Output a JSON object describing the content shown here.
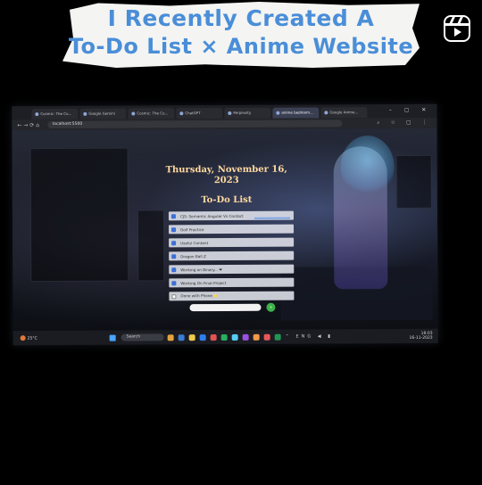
{
  "caption": {
    "line1": "I Recently Created A",
    "line2": "To-Do List × Anime Website"
  },
  "reels_icon": "reels-icon",
  "browser": {
    "tabs": [
      {
        "label": "Cosmic: The Cu..."
      },
      {
        "label": "Google Gemini"
      },
      {
        "label": "Cosmic: The Cu..."
      },
      {
        "label": "ChatGPT"
      },
      {
        "label": "Perplexity"
      },
      {
        "label": "anime bedroom...",
        "active": true
      },
      {
        "label": "Google Anime..."
      }
    ],
    "window_controls": "– ▢ ✕",
    "url": "localhost:5500",
    "nav_icons": "← → ⟳ ⌂"
  },
  "page": {
    "date_heading": "Thursday, November 16, 2023",
    "list_heading": "To-Do List",
    "items": [
      {
        "text": "CJS: Semantic Angular Vs Contact",
        "done": true
      },
      {
        "text": "Golf Practice",
        "done": true
      },
      {
        "text": "Useful Content",
        "done": true
      },
      {
        "text": "Dragon Ball Z",
        "done": true
      },
      {
        "text": "Working on Binary...  ❤",
        "done": true
      },
      {
        "text": "Working On Final Project",
        "done": true
      },
      {
        "text": "Done with Phone  ⭐",
        "done": false
      }
    ],
    "add_button_label": "+"
  },
  "taskbar": {
    "weather_text": "25°C",
    "search_placeholder": "Search",
    "time": "18:03",
    "date": "16-11-2023",
    "tray_icons": "⌃ ENG ◀ ▮"
  },
  "colors": {
    "caption_text": "#4a8ed8",
    "heading_text": "#ffd9a0",
    "checkbox": "#3b6fd8",
    "add_button": "#3db34a"
  }
}
